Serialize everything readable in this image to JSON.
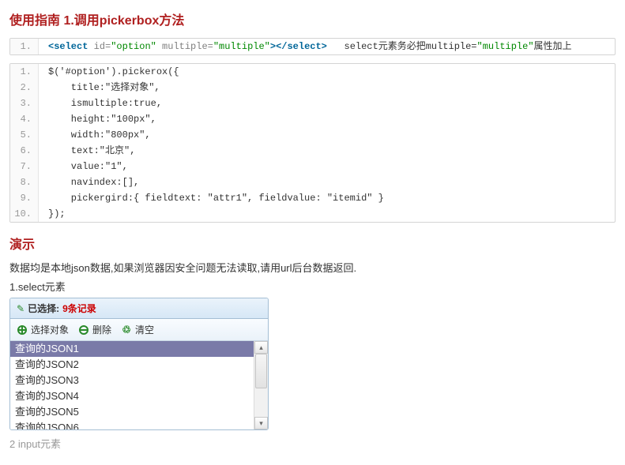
{
  "heading1": "使用指南 1.调用pickerbox方法",
  "code1": {
    "line_no": "1.",
    "seg_open": "<select",
    "seg_id_attr": " id=",
    "seg_id_val": "\"option\"",
    "seg_mult_attr": " multiple=",
    "seg_mult_val": "\"multiple\"",
    "seg_close": "></select>",
    "trail_a": "   select元素务必把multiple=",
    "trail_val": "\"multiple\"",
    "trail_b": "属性加上"
  },
  "code2": [
    {
      "n": "1.",
      "t": "$('#option').pickerox({"
    },
    {
      "n": "2.",
      "t": "    title:\"选择对象\","
    },
    {
      "n": "3.",
      "t": "    ismultiple:true,"
    },
    {
      "n": "4.",
      "t": "    height:\"100px\","
    },
    {
      "n": "5.",
      "t": "    width:\"800px\","
    },
    {
      "n": "6.",
      "t": "    text:\"北京\","
    },
    {
      "n": "7.",
      "t": "    value:\"1\","
    },
    {
      "n": "8.",
      "t": "    navindex:[],"
    },
    {
      "n": "9.",
      "t": "    pickergird:{ fieldtext: \"attr1\", fieldvalue: \"itemid\" }"
    },
    {
      "n": "10.",
      "t": "});"
    }
  ],
  "heading2": "演示",
  "desc1": "数据均是本地json数据,如果浏览器因安全问题无法读取,请用url后台数据返回.",
  "desc2": "1.select元素",
  "picker": {
    "selected_label_a": "已选择:",
    "selected_label_b": "9条记录",
    "tb_select": "选择对象",
    "tb_delete": "删除",
    "tb_clear": "清空",
    "rows": [
      "查询的JSON1",
      "查询的JSON2",
      "查询的JSON3",
      "查询的JSON4",
      "查询的JSON5",
      "查询的JSON6"
    ],
    "arrow_up": "▴",
    "arrow_down": "▾"
  },
  "desc3": "2 input元素"
}
